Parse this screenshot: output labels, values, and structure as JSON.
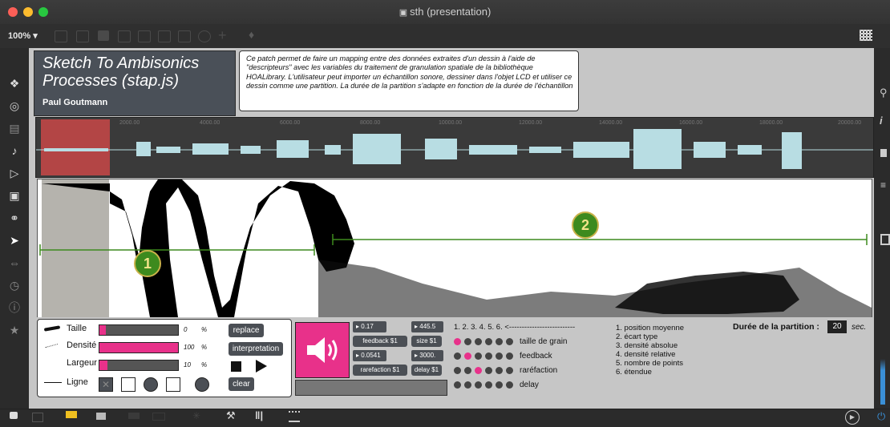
{
  "window": {
    "title": "sth (presentation)"
  },
  "toolbar": {
    "zoom": "100% ▾"
  },
  "patch": {
    "title_line1": "Sketch To Ambisonics",
    "title_line2": "Processes (stap.js)",
    "author": "Paul Goutmann",
    "description": "Ce patch permet de faire un mapping entre des données extraites d'un dessin à l'aide de \"descripteurs\" avec les variables du traitement de granulation spatiale de la bibliothèque HOALibrary. L'utilisateur peut importer un échantillon sonore, dessiner dans l'objet LCD et utiliser ce dessin comme une partition. La durée de la partition s'adapte en fonction de la durée de l'échantillon"
  },
  "waveform": {
    "ticks": [
      "2000.00",
      "4000.00",
      "6000.00",
      "8000.00",
      "10000.00",
      "12000.00",
      "14000.00",
      "16000.00",
      "18000.00",
      "20000.00"
    ],
    "selection_color": "#c94848",
    "wave_color": "#b8dde3"
  },
  "canvas": {
    "marker1": "1",
    "marker2": "2",
    "marker_color": "#3d8a1e"
  },
  "brush": {
    "taille_label": "Taille",
    "taille_value": "0",
    "taille_level": 0.08,
    "densite_label": "Densité",
    "densite_value": "100",
    "densite_level": 1.0,
    "largeur_label": "Largeur",
    "largeur_value": "10",
    "largeur_level": 0.1,
    "ligne_label": "Ligne",
    "unit": "%",
    "replace": "replace",
    "interpretation": "interpretation",
    "clear": "clear"
  },
  "params": {
    "num1": "▸ 0.17",
    "num2": "▸ 445.5",
    "feedback": "feedback $1",
    "size": "size $1",
    "num3": "▸ 0.0541",
    "num4": "▸ 3000.",
    "rarefaction": "rarefaction $1",
    "delay": "delay $1"
  },
  "matrix": {
    "header": "1. 2. 3. 4. 5. 6. <--------------------------",
    "rows": [
      "taille de grain",
      "feedback",
      "raréfaction",
      "delay"
    ],
    "active": [
      0,
      1,
      2,
      -1
    ],
    "on_color": "#e8318a"
  },
  "legend": {
    "items": [
      "1. position moyenne",
      "2. écart type",
      "3. densité absolue",
      "4. densité relative",
      "5. nombre de points",
      "6. étendue"
    ]
  },
  "duration": {
    "label": "Durée de la partition :",
    "value": "20",
    "unit": "sec."
  }
}
